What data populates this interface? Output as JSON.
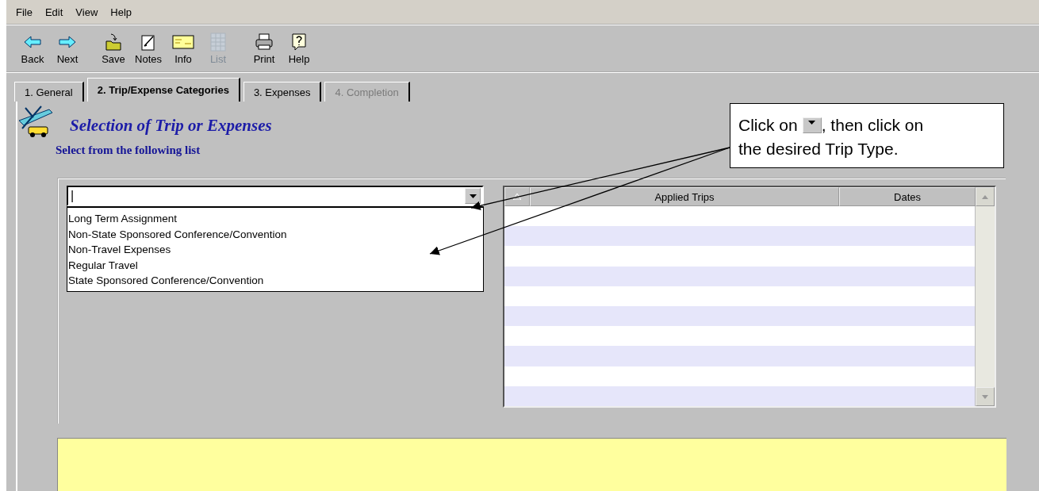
{
  "menu": [
    "File",
    "Edit",
    "View",
    "Help"
  ],
  "toolbar": [
    {
      "kind": "back",
      "label": "Back",
      "disabled": false
    },
    {
      "kind": "next",
      "label": "Next",
      "disabled": false
    },
    {
      "kind": "save",
      "label": "Save",
      "disabled": false
    },
    {
      "kind": "notes",
      "label": "Notes",
      "disabled": false
    },
    {
      "kind": "info",
      "label": "Info",
      "disabled": false
    },
    {
      "kind": "list",
      "label": "List",
      "disabled": true
    },
    {
      "kind": "print",
      "label": "Print",
      "disabled": false
    },
    {
      "kind": "help",
      "label": "Help",
      "disabled": false
    }
  ],
  "tabs": [
    {
      "label": "1. General",
      "selected": false,
      "disabled": false
    },
    {
      "label": "2. Trip/Expense Categories",
      "selected": true,
      "disabled": false
    },
    {
      "label": "3. Expenses",
      "selected": false,
      "disabled": false
    },
    {
      "label": "4. Completion",
      "selected": false,
      "disabled": true
    }
  ],
  "heading": {
    "title": "Selection of Trip or Expenses",
    "subtitle": "Select from the following list"
  },
  "combo": {
    "value": "|",
    "options": [
      "Long Term Assignment",
      "Non-State Sponsored Conference/Convention",
      "Non-Travel Expenses",
      "Regular Travel",
      "State Sponsored Conference/Convention"
    ]
  },
  "table": {
    "columns": [
      "Applied Trips",
      "Dates"
    ]
  },
  "callout": {
    "before": "Click on",
    "after": ", then click on",
    "line2": "the desired Trip Type."
  }
}
